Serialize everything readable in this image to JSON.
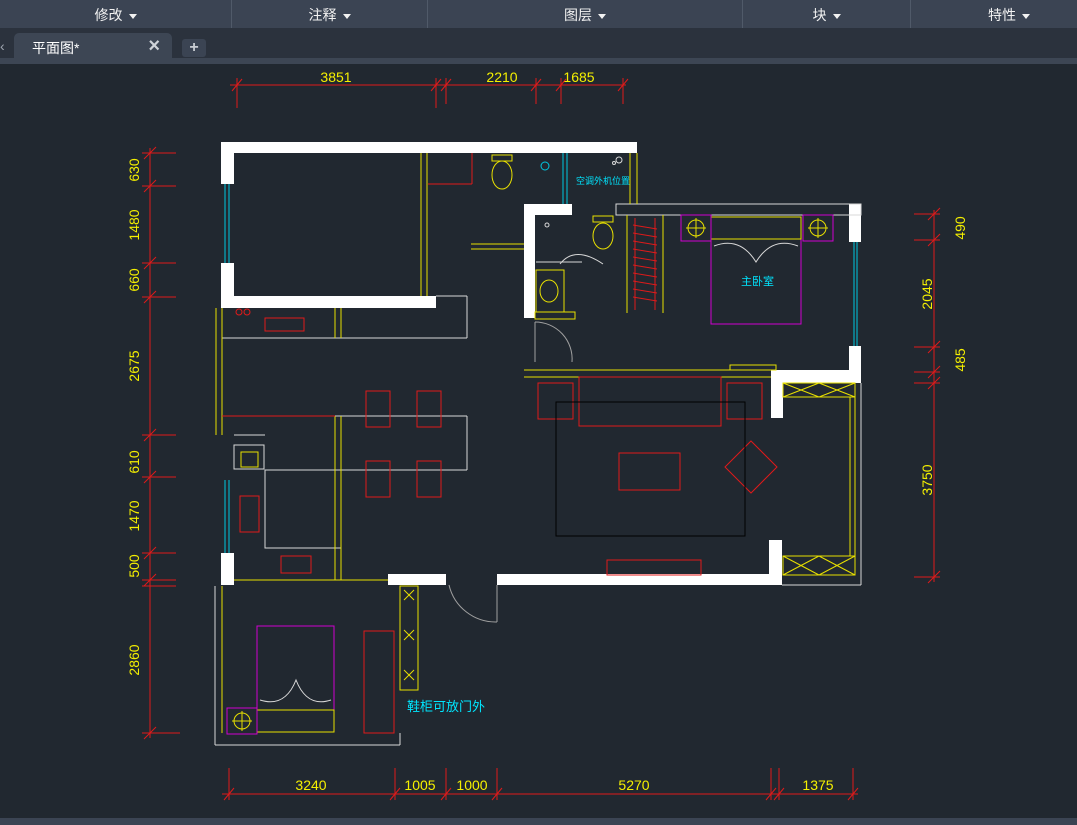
{
  "menus": [
    {
      "label": "修改"
    },
    {
      "label": "注释"
    },
    {
      "label": "图层"
    },
    {
      "label": "块"
    },
    {
      "label": "特性"
    }
  ],
  "tabs": [
    {
      "title": "平面图*"
    }
  ],
  "drawing": {
    "dims_top": [
      "3851",
      "2210",
      "1685"
    ],
    "dims_bottom": [
      "3240",
      "1005",
      "1000",
      "5270",
      "1375"
    ],
    "dims_left": [
      "630",
      "1480",
      "660",
      "2675",
      "610",
      "1470",
      "500",
      "2860"
    ],
    "dims_right": [
      "490",
      "2045",
      "485",
      "3750"
    ],
    "labels": {
      "ac": "空调外机位置",
      "master_bedroom": "主卧室",
      "shoe_cabinet": "鞋柜可放门外"
    }
  },
  "colors": {
    "background": "#212830",
    "dimension": "#f5f000",
    "dim_line": "#e01a1a",
    "wall": "#ffffff",
    "furniture": "#e01a1a",
    "label": "#00e6ff"
  }
}
